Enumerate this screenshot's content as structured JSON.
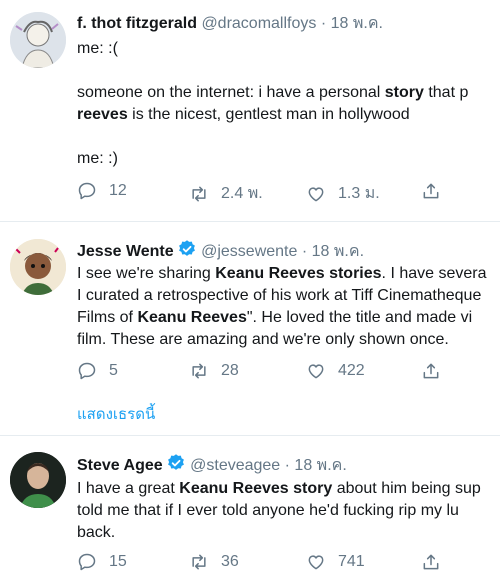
{
  "tweets": [
    {
      "name": "f. thot fitzgerald",
      "handle": "@dracomallfoys",
      "date": "· 18 พ.ค.",
      "verified": false,
      "lines": [
        [
          {
            "t": "me: :("
          }
        ],
        [
          {
            "t": ""
          }
        ],
        [
          {
            "t": "someone on the internet: i have a personal "
          },
          {
            "t": "story",
            "b": true
          },
          {
            "t": " that p"
          }
        ],
        [
          {
            "t": "reeves",
            "b": true
          },
          {
            "t": " is the nicest, gentlest man in hollywood"
          }
        ],
        [
          {
            "t": ""
          }
        ],
        [
          {
            "t": "me: :)"
          }
        ]
      ],
      "reply": "12",
      "retweet": "2.4 พ.",
      "like": "1.3 ม."
    },
    {
      "name": "Jesse Wente",
      "handle": "@jessewente",
      "date": "· 18 พ.ค.",
      "verified": true,
      "lines": [
        [
          {
            "t": "I see we're sharing "
          },
          {
            "t": "Keanu Reeves stories",
            "b": true
          },
          {
            "t": ". I have severa"
          }
        ],
        [
          {
            "t": "I curated a retrospective of his work at Tiff Cinematheque"
          }
        ],
        [
          {
            "t": "Films of "
          },
          {
            "t": "Keanu Reeves",
            "b": true
          },
          {
            "t": "\". He loved the title and made vi"
          }
        ],
        [
          {
            "t": "film. These are amazing and we're only shown once."
          }
        ]
      ],
      "reply": "5",
      "retweet": "28",
      "like": "422"
    },
    {
      "name": "Steve Agee",
      "handle": "@steveagee",
      "date": "· 18 พ.ค.",
      "verified": true,
      "lines": [
        [
          {
            "t": "I have a great "
          },
          {
            "t": "Keanu Reeves story",
            "b": true
          },
          {
            "t": " about him being sup"
          }
        ],
        [
          {
            "t": "told me that if I ever told anyone he'd fucking rip my lu"
          }
        ],
        [
          {
            "t": "back."
          }
        ]
      ],
      "reply": "15",
      "retweet": "36",
      "like": "741"
    }
  ],
  "show_thread": "แสดงเธรดนี้",
  "colors": {
    "verified": "#1da1f2",
    "link": "#1da1f2",
    "muted": "#657786"
  }
}
